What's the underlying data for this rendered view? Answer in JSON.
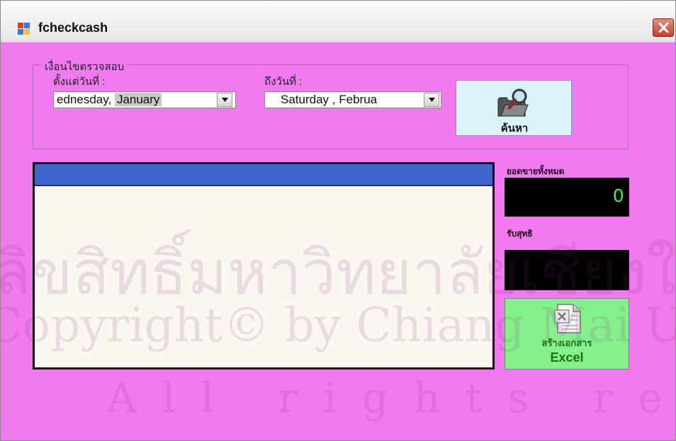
{
  "window": {
    "title": "fcheckcash",
    "bg_color": "#f27af0"
  },
  "filter": {
    "group_label": "เงื่อนไขตรวจสอบ",
    "from_label": "ตั้งแต่วันที่ :",
    "from_day": "ednesday,",
    "from_month": "January",
    "to_label": "ถึงวันที่ :",
    "to_day": "Saturday  ,",
    "to_month": "Februa",
    "search_label": "ค้นหา"
  },
  "summary": {
    "total_sales_label": "ยอดขายทั้งหมด",
    "total_sales_value": "0",
    "net_label": "รับสุทธิ",
    "net_value": ""
  },
  "export": {
    "line1": "สร้างเอกสาร",
    "line2": "Excel"
  },
  "watermark": {
    "line1": "ลิขสิทธิ์มหาวิทยาลัยเชียงใหม่",
    "line2": "Copyright© by Chiang Mai University",
    "line3": "All rights reserved"
  }
}
